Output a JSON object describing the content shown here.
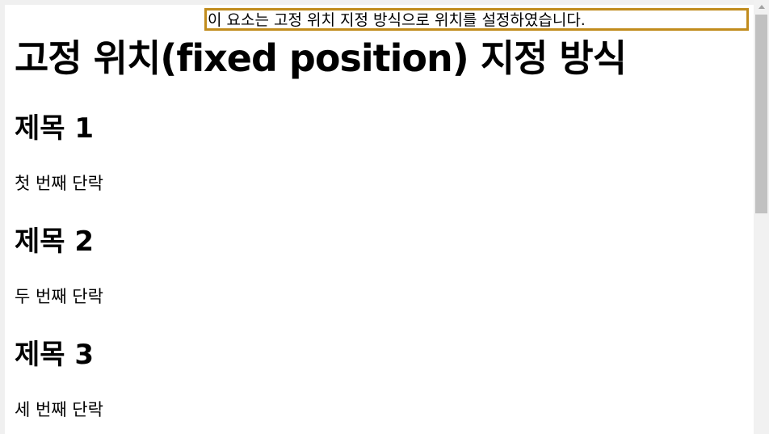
{
  "page": {
    "title": "고정 위치(fixed position) 지정 방식",
    "sections": [
      {
        "heading": "제목 1",
        "paragraph": "첫 번째 단락"
      },
      {
        "heading": "제목 2",
        "paragraph": "두 번째 단락"
      },
      {
        "heading": "제목 3",
        "paragraph": "세 번째 단락"
      }
    ]
  },
  "fixed_box": {
    "text": "이 요소는 고정 위치 지정 방식으로 위치를 설정하였습니다.",
    "border_color": "#c18c1d"
  },
  "scrollbar": {
    "position_fraction": 0.0
  }
}
